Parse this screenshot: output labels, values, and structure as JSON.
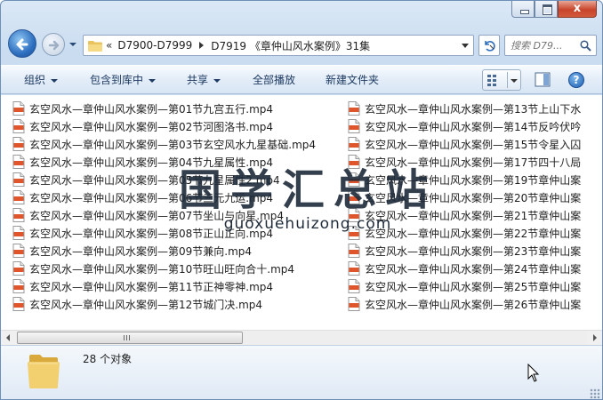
{
  "window": {
    "caption": {
      "minimize": "minimize",
      "maximize": "maximize",
      "close_glyph": "x"
    }
  },
  "nav": {
    "address": {
      "overflow": "«",
      "crumbs": [
        "D7900-D7999",
        "D7919 《章仲山风水案例》31集"
      ]
    },
    "search": {
      "placeholder": "搜索 D79..."
    }
  },
  "toolbar": {
    "organize": "组织",
    "include_in_library": "包含到库中",
    "share": "共享",
    "play_all": "全部播放",
    "new_folder": "新建文件夹"
  },
  "files": {
    "left": [
      "玄空风水—章仲山风水案例—第01节九宫五行.mp4",
      "玄空风水—章仲山风水案例—第02节河图洛书.mp4",
      "玄空风水—章仲山风水案例—第03节玄空风水九星基础.mp4",
      "玄空风水—章仲山风水案例—第04节九星属性.mp4",
      "玄空风水—章仲山风水案例—第05节九星属性2.mp4",
      "玄空风水—章仲山风水案例—第06节三元九运.mp4",
      "玄空风水—章仲山风水案例—第07节坐山与向星.mp4",
      "玄空风水—章仲山风水案例—第08节正山正向.mp4",
      "玄空风水—章仲山风水案例—第09节兼向.mp4",
      "玄空风水—章仲山风水案例—第10节旺山旺向合十.mp4",
      "玄空风水—章仲山风水案例—第11节正神零神.mp4",
      "玄空风水—章仲山风水案例—第12节城门决.mp4"
    ],
    "right": [
      "玄空风水—章仲山风水案例—第13节上山下水",
      "玄空风水—章仲山风水案例—第14节反吟伏吟",
      "玄空风水—章仲山风水案例—第15节令星入囚",
      "玄空风水—章仲山风水案例—第17节四十八局",
      "玄空风水—章仲山风水案例—第19节章仲山案",
      "玄空风水—章仲山风水案例—第20节章仲山案",
      "玄空风水—章仲山风水案例—第21节章仲山案",
      "玄空风水—章仲山风水案例—第22节章仲山案",
      "玄空风水—章仲山风水案例—第23节章仲山案",
      "玄空风水—章仲山风水案例—第24节章仲山案",
      "玄空风水—章仲山风水案例—第25节章仲山案",
      "玄空风水—章仲山风水案例—第26节章仲山案"
    ],
    "icon": "mp4-file-icon"
  },
  "watermark": {
    "title": "国学汇总站",
    "url": "guoxuehuizong.com"
  },
  "details": {
    "count": "28 个对象"
  },
  "colors": {
    "accent": "#2e6fc0",
    "close": "#c8452b",
    "mp4_icon": "#e0552b"
  }
}
